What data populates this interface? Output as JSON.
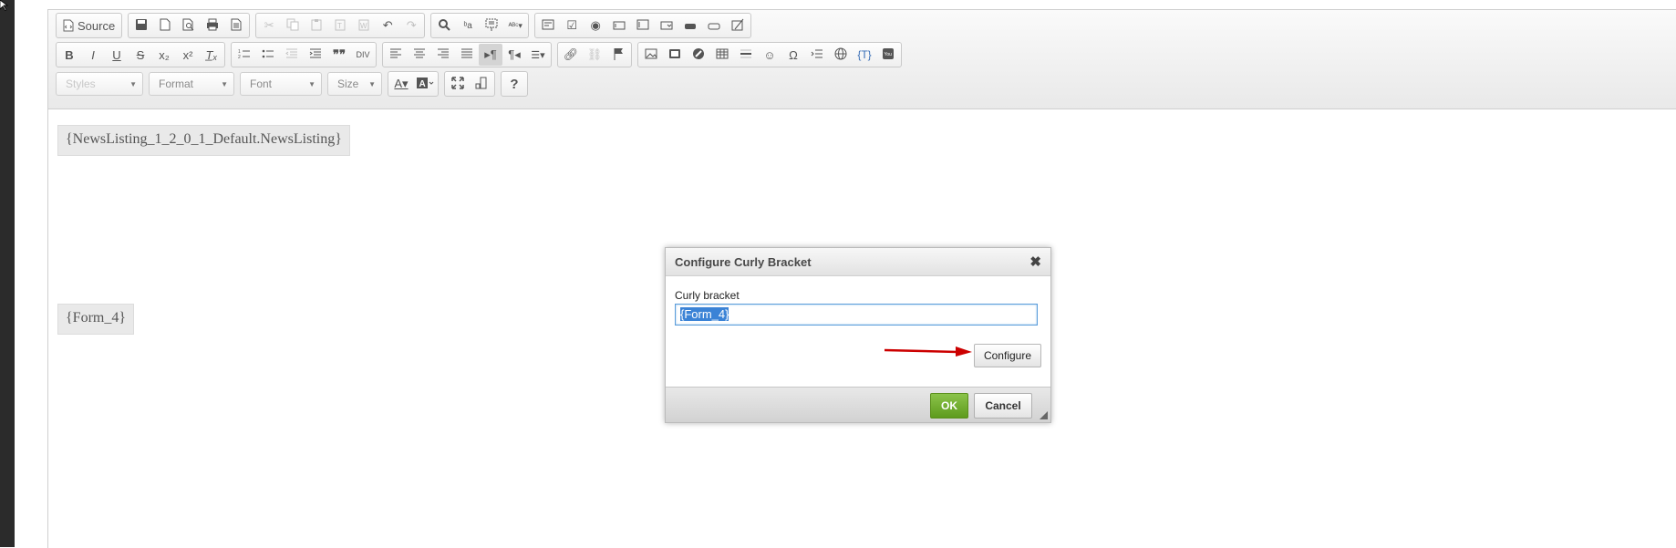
{
  "toolbar": {
    "row1": {
      "source_label": "Source"
    },
    "row3": {
      "styles_label": "Styles",
      "format_label": "Format",
      "font_label": "Font",
      "size_label": "Size",
      "help_label": "?"
    }
  },
  "content": {
    "placeholder1": "{NewsListing_1_2_0_1_Default.NewsListing}",
    "placeholder2": "{Form_4}"
  },
  "dialog": {
    "title": "Configure Curly Bracket",
    "field_label": "Curly bracket",
    "field_value": "{Form_4}",
    "configure_label": "Configure",
    "ok_label": "OK",
    "cancel_label": "Cancel"
  },
  "colors": {
    "accent_arrow": "#cc0000",
    "ok_green": "#6aa526",
    "selection": "#3b83d6"
  }
}
